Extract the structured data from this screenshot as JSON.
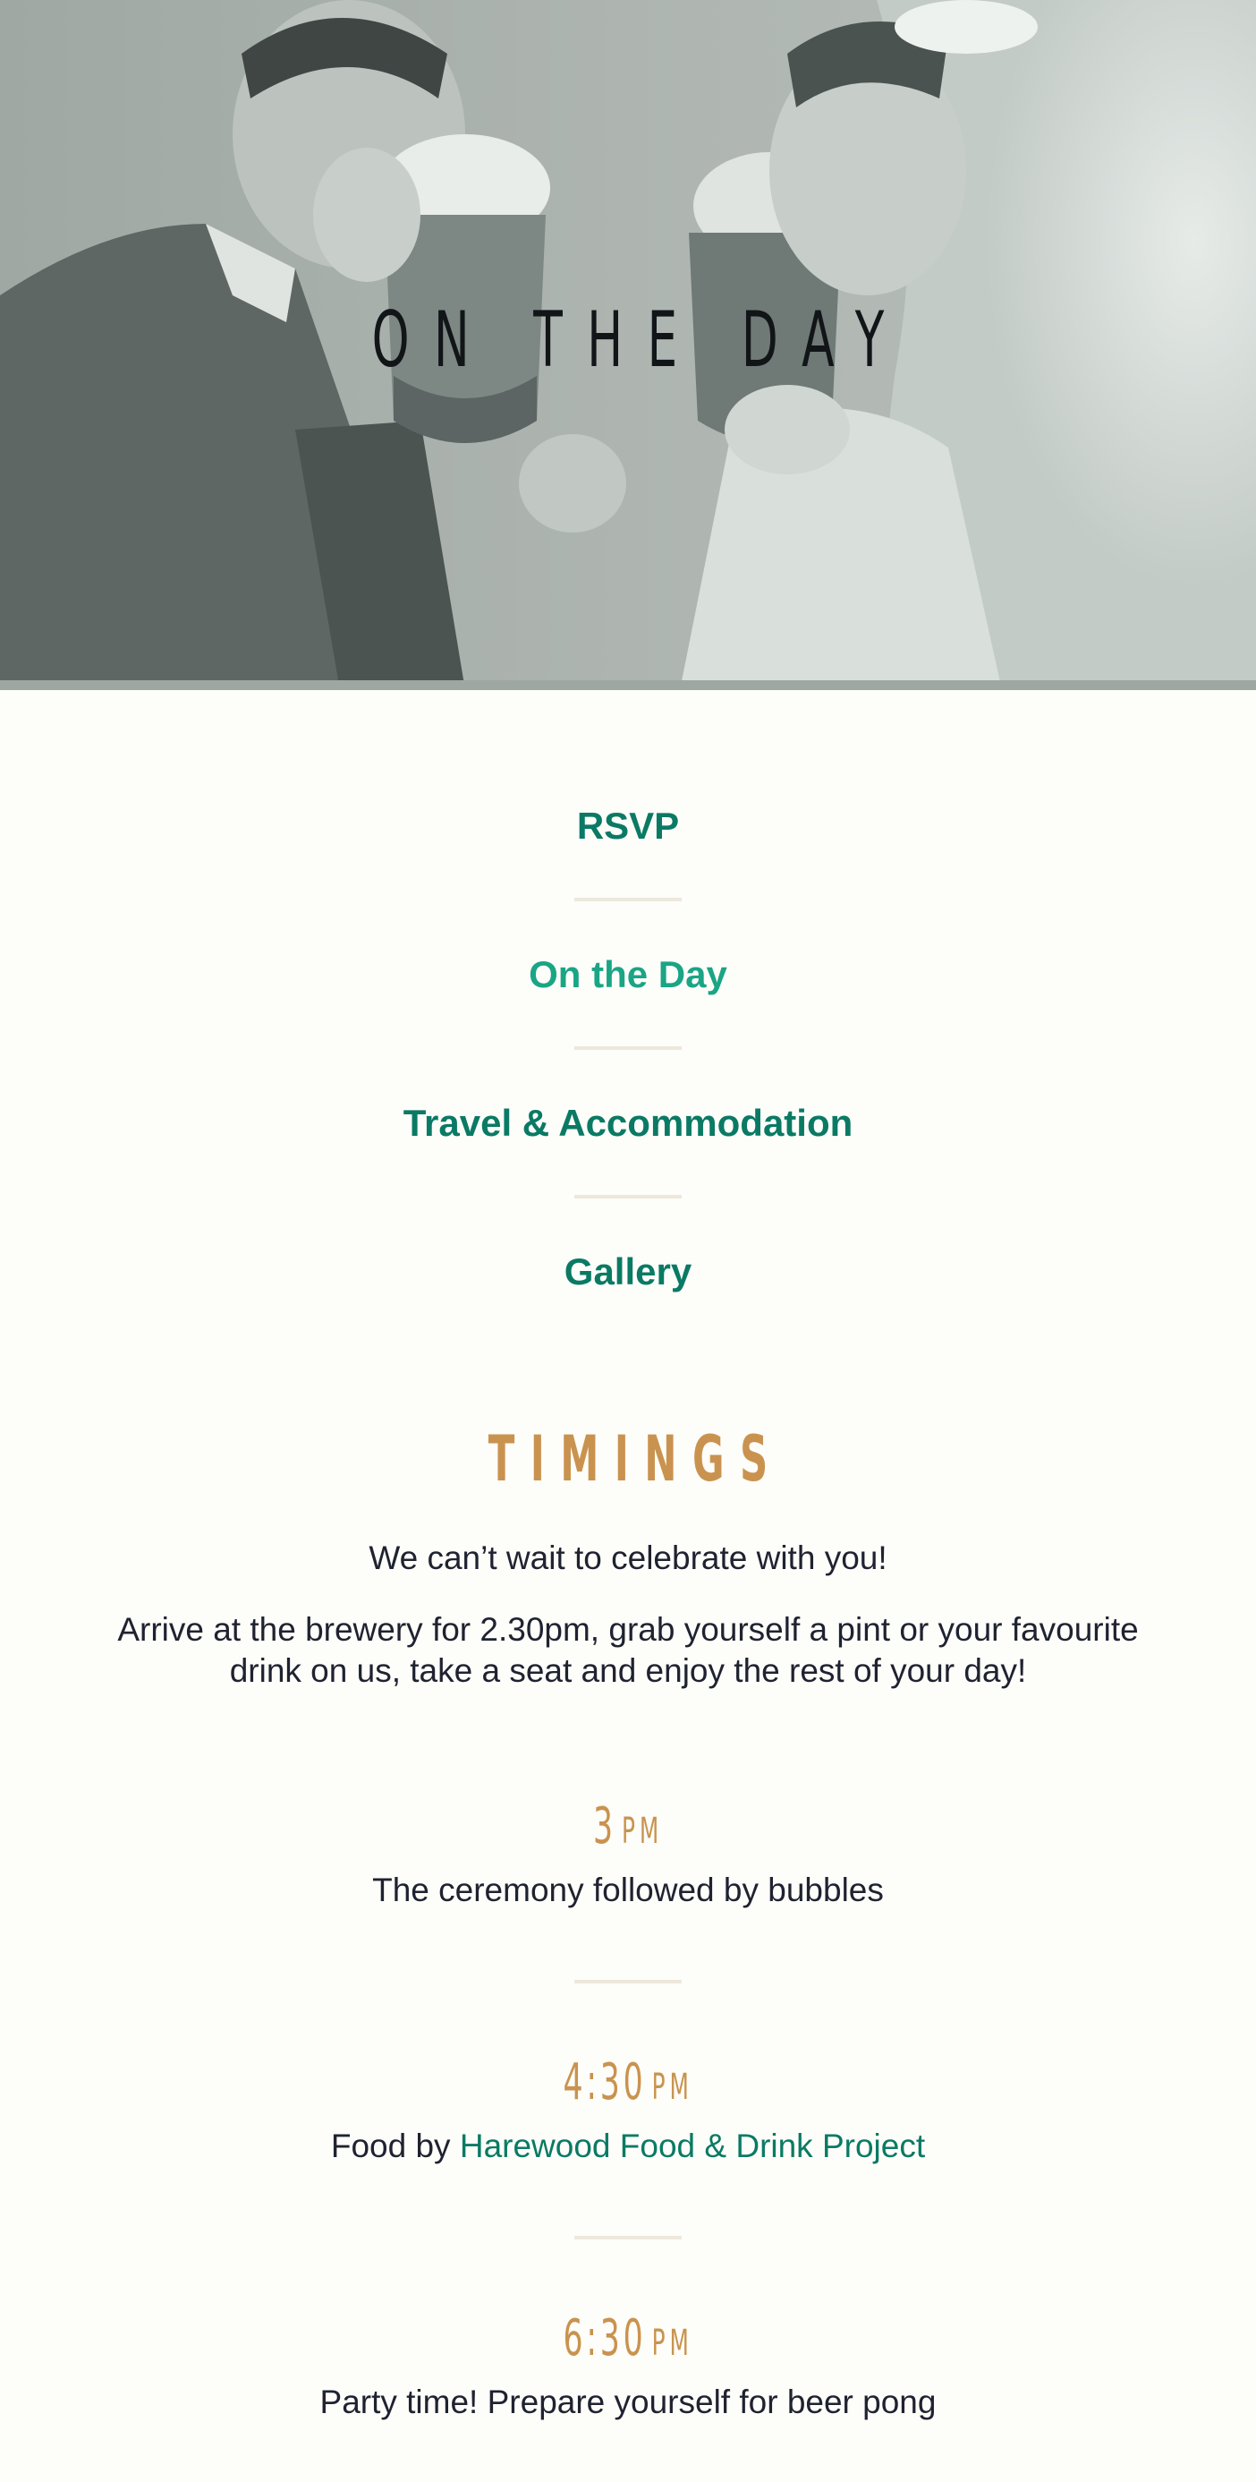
{
  "hero": {
    "title": "ON THE DAY"
  },
  "nav": {
    "items": [
      {
        "label": "RSVP",
        "active": false
      },
      {
        "label": "On the Day",
        "active": true
      },
      {
        "label": "Travel & Accommodation",
        "active": false
      },
      {
        "label": "Gallery",
        "active": false
      }
    ]
  },
  "timings": {
    "title": "TIMINGS",
    "intro": [
      "We can’t wait to celebrate with you!",
      "Arrive at the brewery for 2.30pm, grab yourself a pint or your favourite drink on us, take a seat and enjoy the rest of your day!"
    ],
    "events": [
      {
        "time": "3",
        "ampm": "PM",
        "desc_prefix": "The ceremony followed by bubbles",
        "link": ""
      },
      {
        "time": "4:30",
        "ampm": "PM",
        "desc_prefix": "Food by ",
        "link": "Harewood Food & Drink Project"
      },
      {
        "time": "6:30",
        "ampm": "PM",
        "desc_prefix": "Party time! Prepare yourself for beer pong",
        "link": ""
      }
    ]
  },
  "colors": {
    "accent_green": "#0a7a64",
    "active_green": "#1aa585",
    "gold": "#c9934f",
    "background": "#fdfdf9"
  }
}
